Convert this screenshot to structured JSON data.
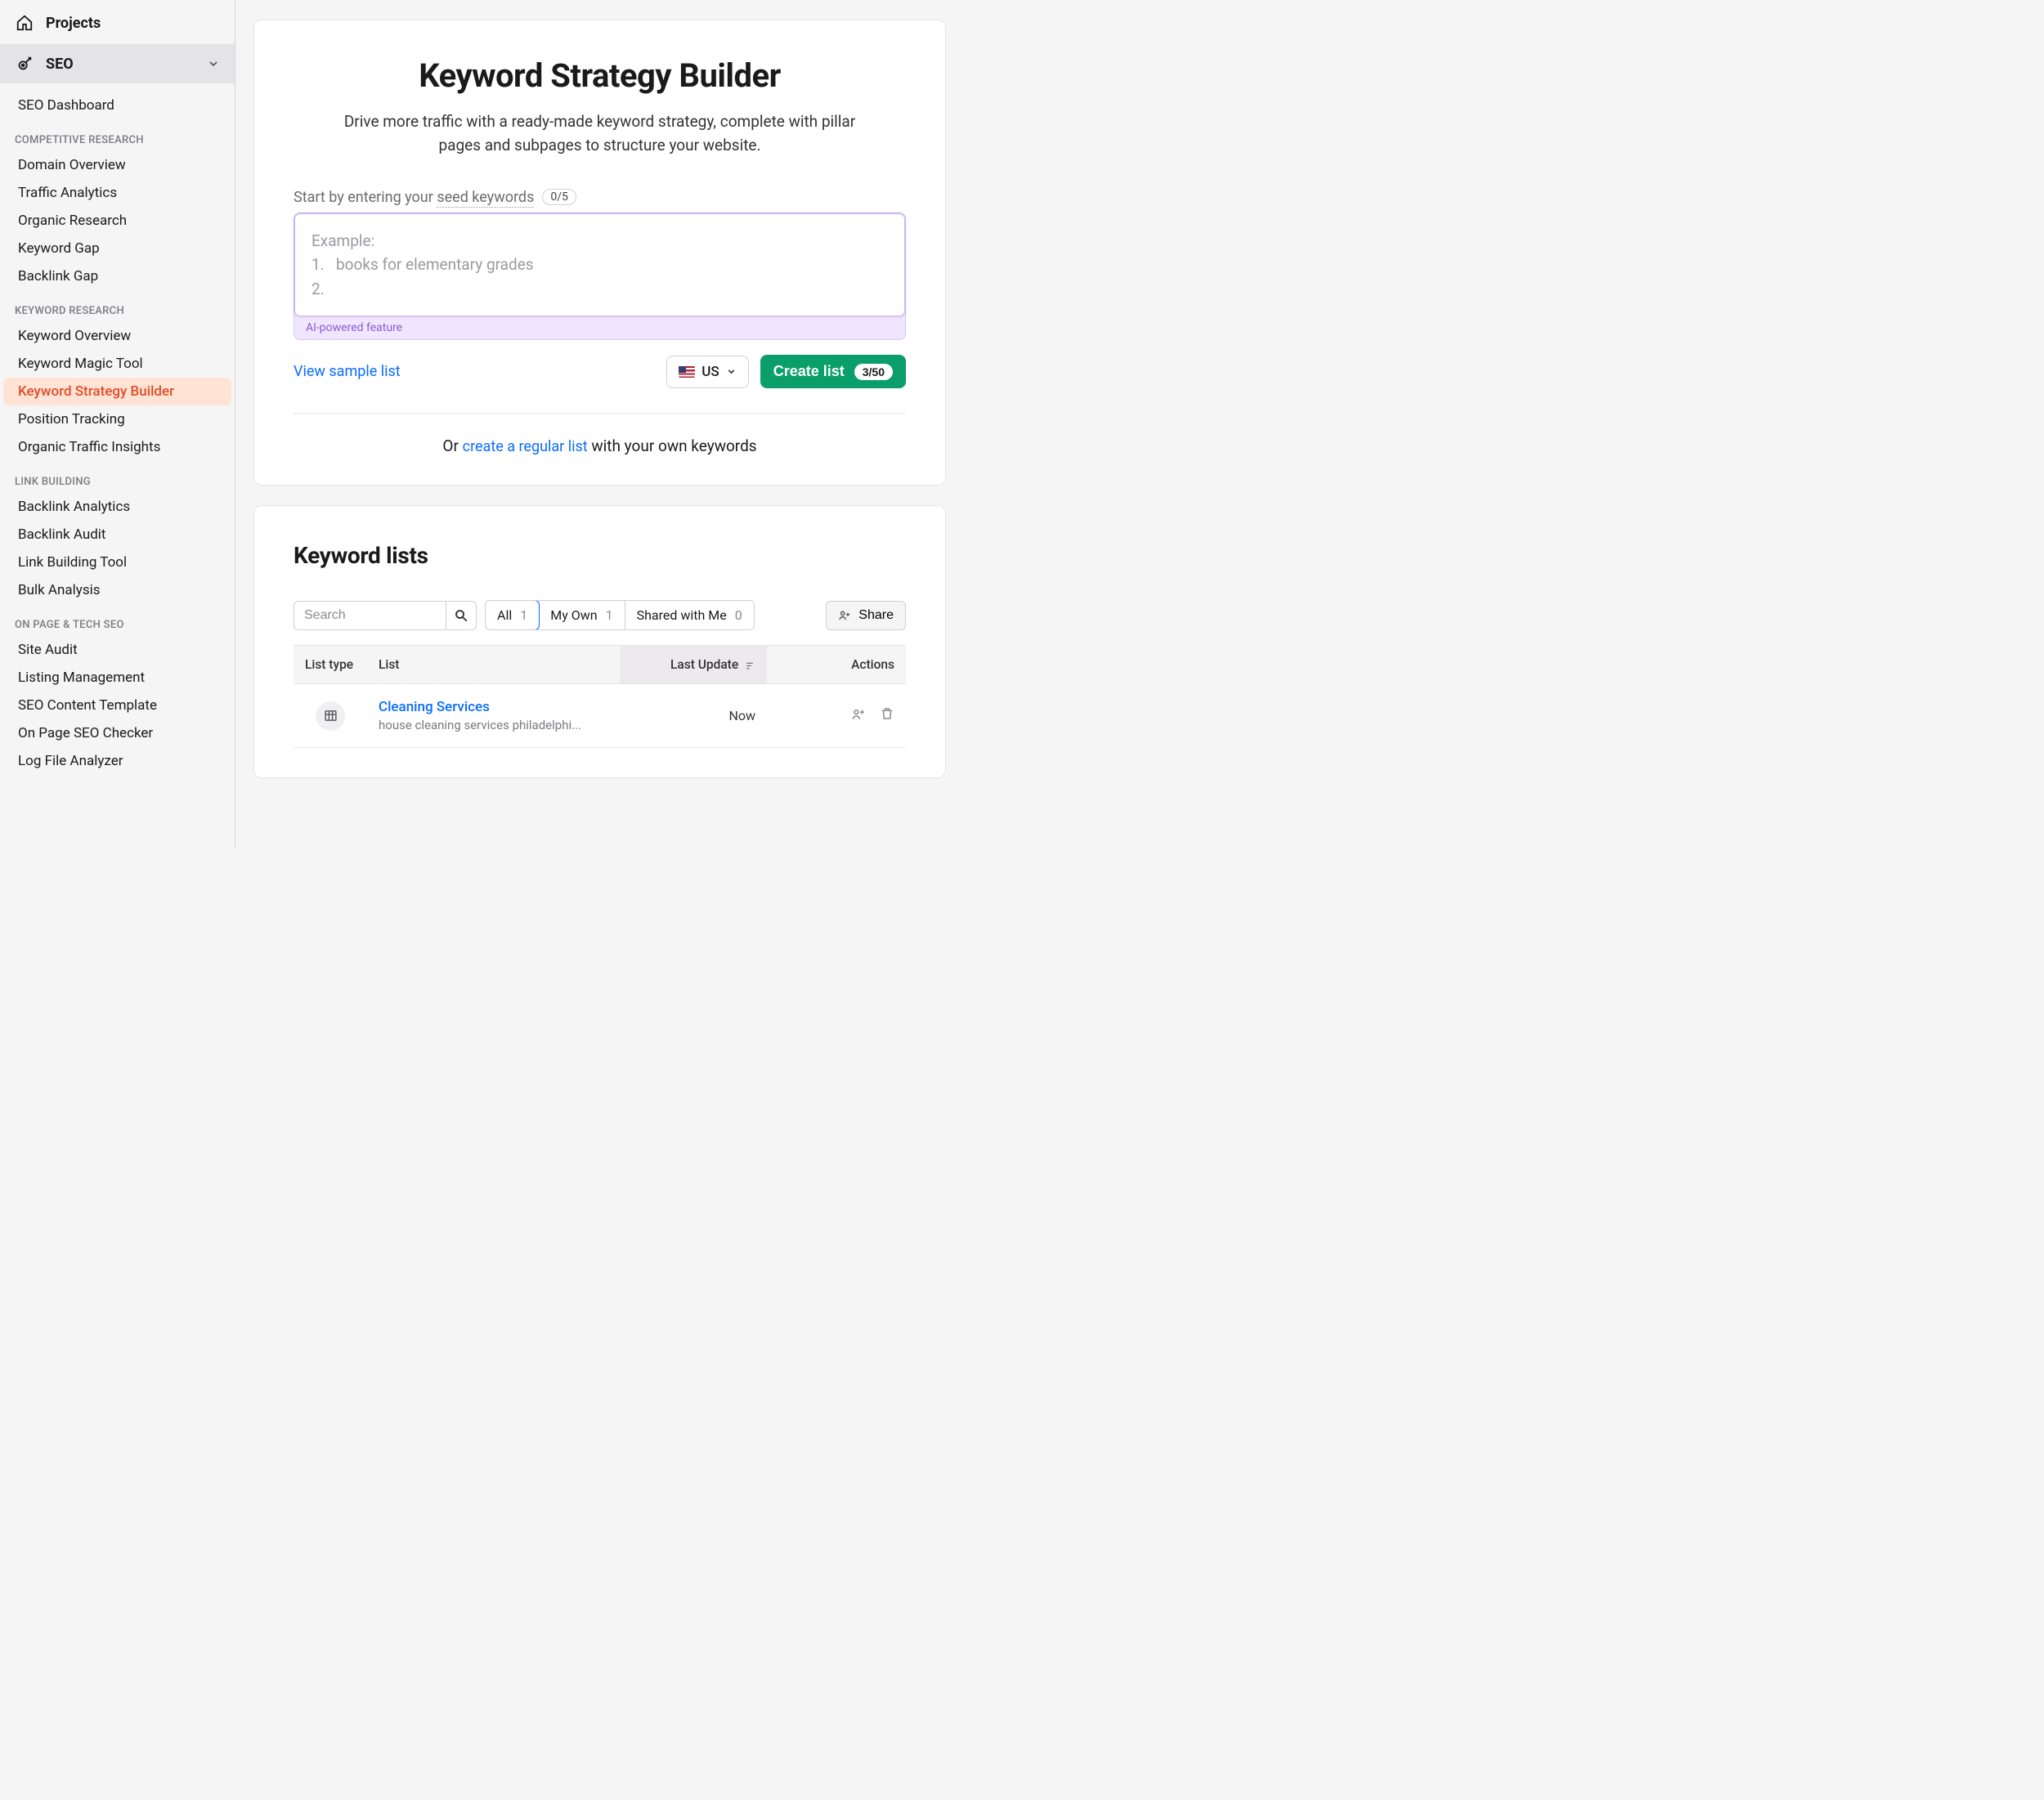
{
  "sidebar": {
    "projects": "Projects",
    "section": "SEO",
    "items": {
      "seo_dashboard": "SEO Dashboard"
    },
    "groups": [
      {
        "title": "COMPETITIVE RESEARCH",
        "links": [
          "Domain Overview",
          "Traffic Analytics",
          "Organic Research",
          "Keyword Gap",
          "Backlink Gap"
        ]
      },
      {
        "title": "KEYWORD RESEARCH",
        "links": [
          "Keyword Overview",
          "Keyword Magic Tool",
          "Keyword Strategy Builder",
          "Position Tracking",
          "Organic Traffic Insights"
        ]
      },
      {
        "title": "LINK BUILDING",
        "links": [
          "Backlink Analytics",
          "Backlink Audit",
          "Link Building Tool",
          "Bulk Analysis"
        ]
      },
      {
        "title": "ON PAGE & TECH SEO",
        "links": [
          "Site Audit",
          "Listing Management",
          "SEO Content Template",
          "On Page SEO Checker",
          "Log File Analyzer"
        ]
      }
    ],
    "active_link": "Keyword Strategy Builder"
  },
  "hero": {
    "title": "Keyword Strategy Builder",
    "subtitle": "Drive more traffic with a ready-made keyword strategy, complete with pillar pages and subpages to structure your website.",
    "seed_label_prefix": "Start by entering your ",
    "seed_label_underlined": "seed keywords",
    "seed_count": "0/5",
    "placeholder_title": "Example:",
    "placeholder_line1": "books for elementary grades",
    "ai_tag": "AI-powered feature",
    "view_sample": "View sample list",
    "country": "US",
    "create_label": "Create list",
    "create_count": "3/50",
    "or_text_prefix": "Or ",
    "or_text_link": "create a regular list",
    "or_text_suffix": " with your own keywords"
  },
  "lists": {
    "title": "Keyword lists",
    "search_placeholder": "Search",
    "filters": [
      {
        "label": "All",
        "count": "1"
      },
      {
        "label": "My Own",
        "count": "1"
      },
      {
        "label": "Shared with Me",
        "count": "0"
      }
    ],
    "share_label": "Share",
    "columns": {
      "type": "List type",
      "list": "List",
      "last_update": "Last Update",
      "actions": "Actions"
    },
    "rows": [
      {
        "name": "Cleaning Services",
        "sub": "house cleaning services philadelphi...",
        "update": "Now"
      }
    ]
  }
}
